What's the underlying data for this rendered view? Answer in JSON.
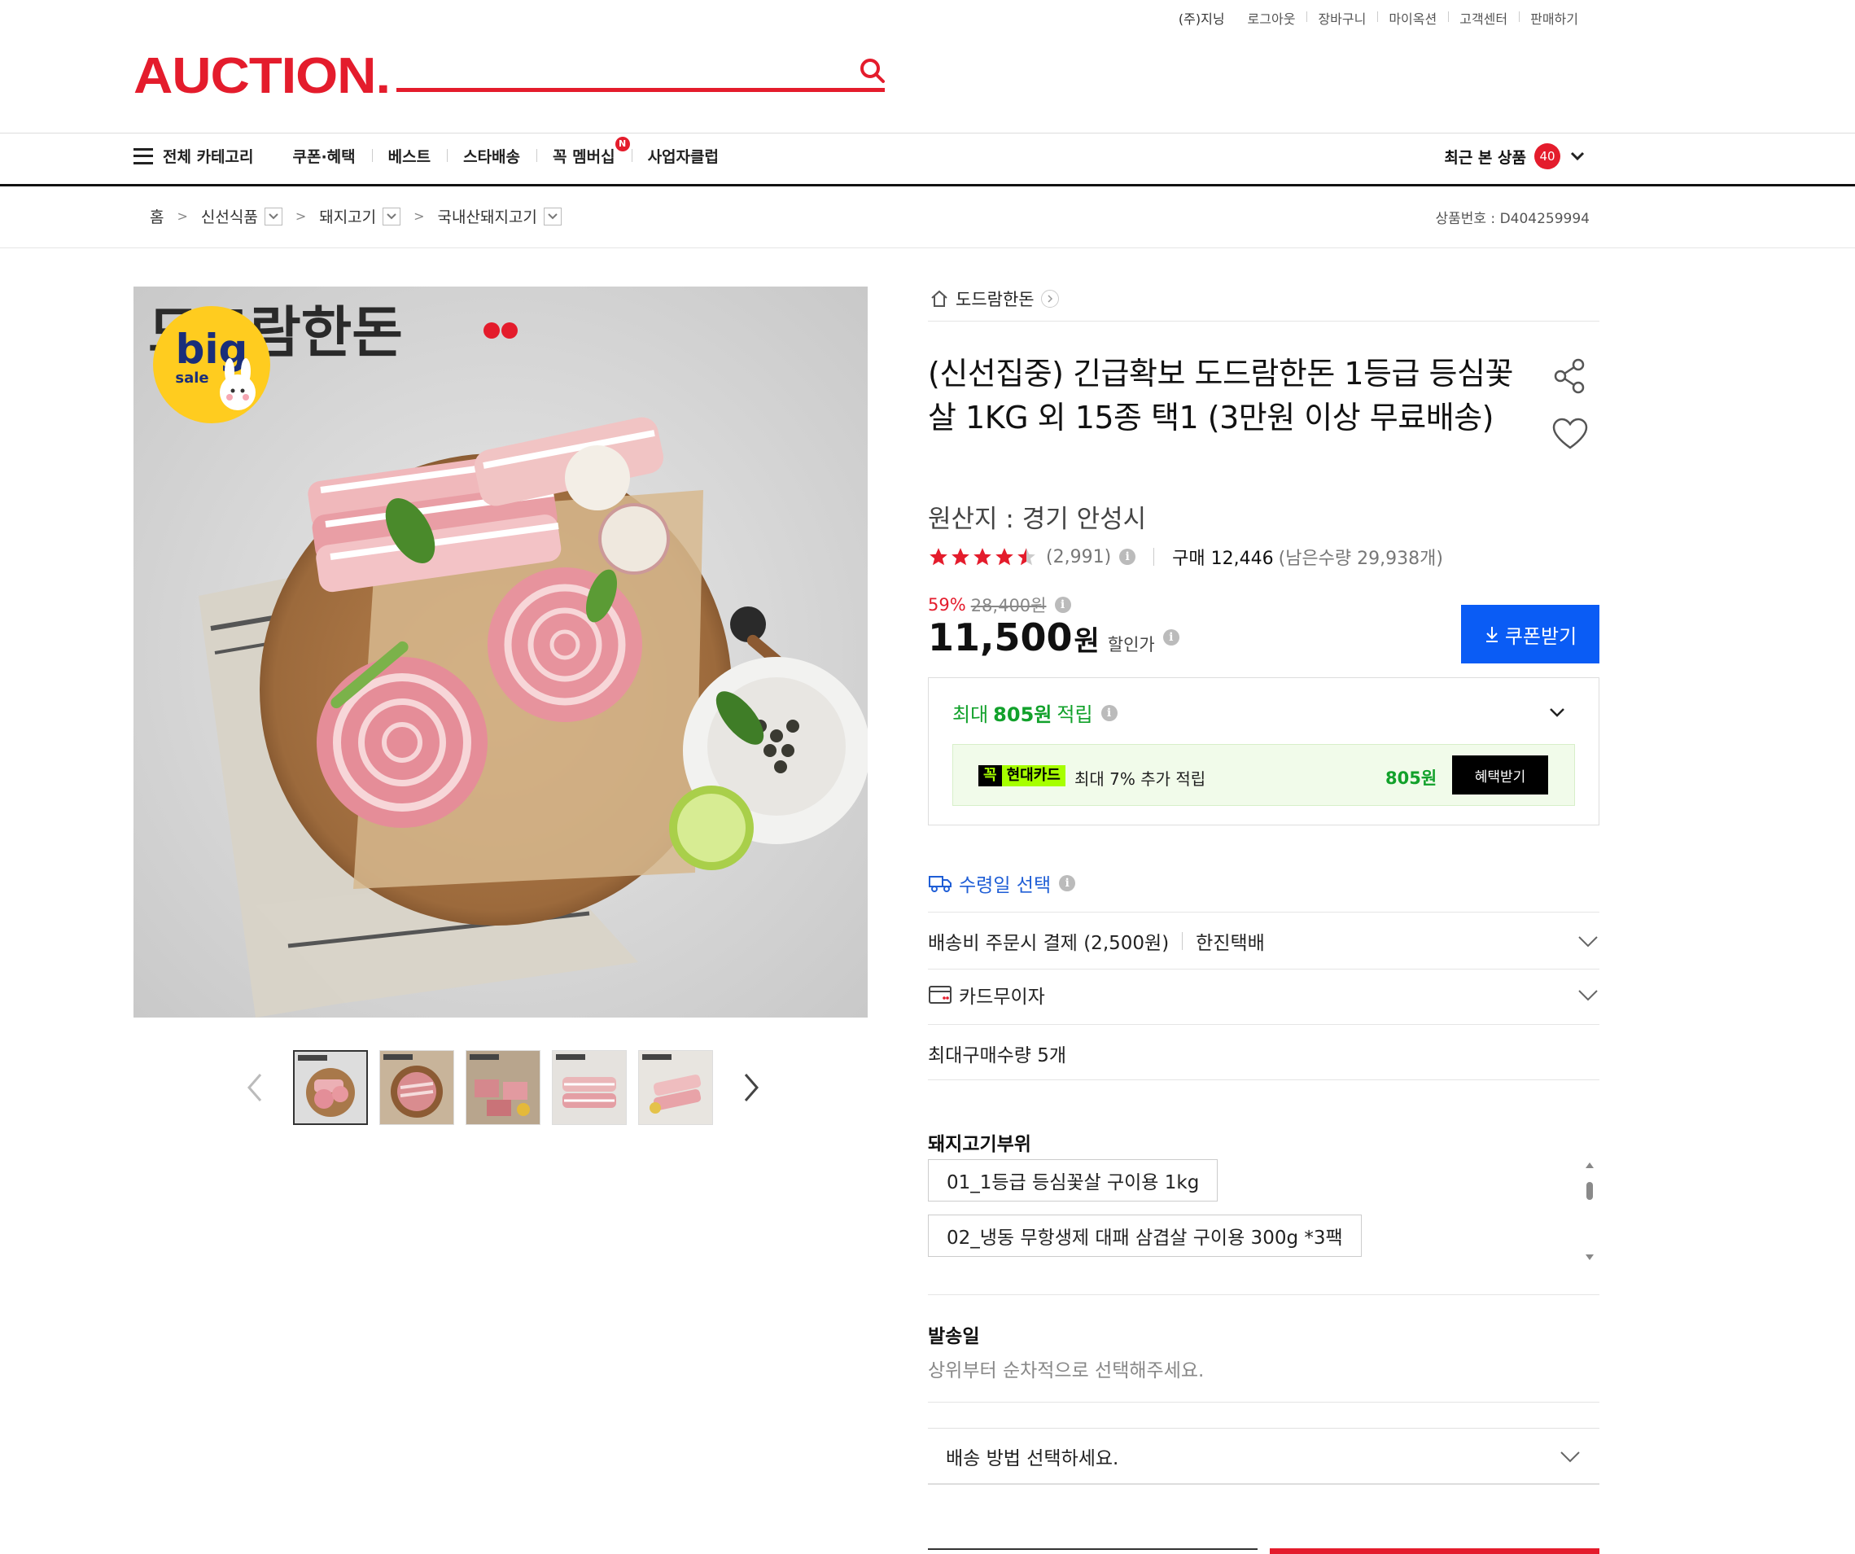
{
  "util": {
    "user": "(주)지닝",
    "links": [
      "로그아웃",
      "장바구니",
      "마이옥션",
      "고객센터",
      "판매하기"
    ]
  },
  "logo": {
    "text": "AUCTION."
  },
  "search": {
    "placeholder": "",
    "value": ""
  },
  "nav": {
    "all_categories": "전체 카테고리",
    "menu": [
      "쿠폰·혜택",
      "베스트",
      "스타배송",
      "꼭 멤버십",
      "사업자클럽"
    ],
    "membership_badge": "N",
    "recent_label": "최근 본 상품",
    "recent_count": "40"
  },
  "breadcrumb": {
    "home": "홈",
    "items": [
      "신선식품",
      "돼지고기",
      "국내산돼지고기"
    ],
    "product_no_label": "상품번호 :",
    "product_no": "D404259994"
  },
  "image": {
    "brand_overlay": "도드람한돈",
    "badge_big": "big",
    "badge_sale": "sale"
  },
  "product": {
    "shop_name": "도드람한돈",
    "title": "(신선집중) 긴급확보 도드람한돈 1등급 등심꽃살 1KG 외 15종 택1 (3만원 이상 무료배송)",
    "origin": "원산지 : 경기 안성시",
    "rating_stars": 4.5,
    "review_count": "(2,991)",
    "purchase_label": "구매 12,446",
    "remain_label": "(남은수량 29,938개)",
    "discount_pct": "59%",
    "original_price": "28,400원",
    "price": "11,500",
    "price_unit": "원",
    "price_label": "할인가",
    "coupon_button": "쿠폰받기"
  },
  "reward": {
    "prefix": "최대",
    "amount": "805원",
    "suffix": "적립",
    "card_k": "꼭",
    "card_name": "현대카드",
    "card_text": "최대 7% 추가 적립",
    "card_amount": "805원",
    "benefit_button": "혜택받기"
  },
  "delivery": {
    "select_date": "수령일 선택",
    "shipping_fee": "배송비 주문시 결제 (2,500원)",
    "courier": "한진택배",
    "card_installment": "카드무이자",
    "max_qty": "최대구매수량 5개"
  },
  "options": {
    "title": "돼지고기부위",
    "items": [
      "01_1등급 등심꽃살 구이용 1kg",
      "02_냉동 무항생제 대패 삼겹살 구이용 300g *3팩"
    ]
  },
  "send": {
    "title": "발송일",
    "subtitle": "상위부터 순차적으로 선택해주세요.",
    "ship_method": "배송 방법 선택하세요."
  },
  "colors": {
    "brand": "#e41c2c",
    "coupon": "#0a5cf5",
    "reward": "#12a12b",
    "hyundai": "#a6ff00"
  }
}
